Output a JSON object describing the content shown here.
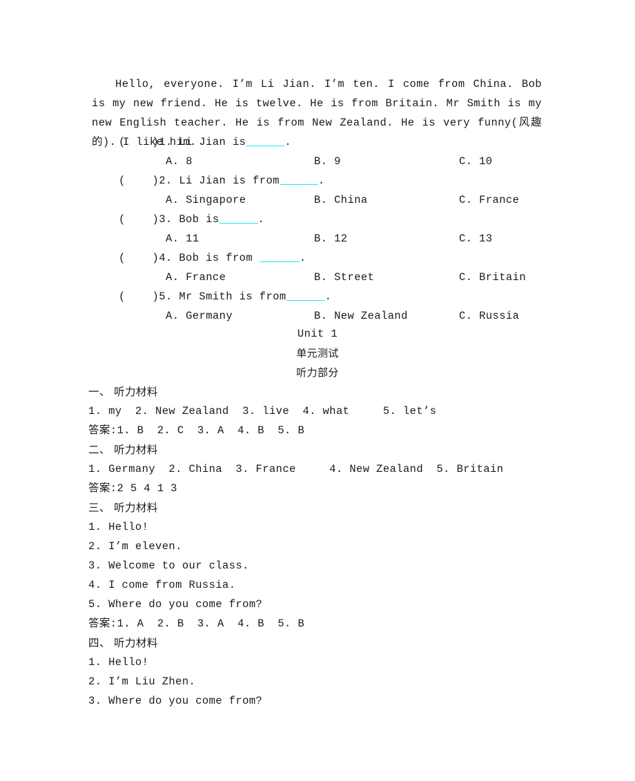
{
  "passage": {
    "text": "Hello, everyone. I’m Li Jian. I’m ten. I come from China. Bob is my new friend. He is twelve. He is from Britain. Mr Smith is my new English teacher. He is from New Zealand. He is very funny(风趣的). I like him."
  },
  "blank_color": "#19e8f0",
  "questions": [
    {
      "marker": "(    )1.",
      "stem_before": " Li Jian is",
      "stem_after": ".",
      "options": [
        "A. 8",
        "B. 9",
        "C. 10"
      ]
    },
    {
      "marker": "(    )2.",
      "stem_before": " Li Jian is from",
      "stem_after": ".",
      "options": [
        "A. Singapore",
        "B. China",
        "C. France"
      ]
    },
    {
      "marker": "(    )3.",
      "stem_before": " Bob is",
      "stem_after": ".",
      "options": [
        "A. 11",
        "B. 12",
        "C. 13"
      ]
    },
    {
      "marker": "(    )4.",
      "stem_before": " Bob is from ",
      "stem_after": ".",
      "options": [
        "A. France",
        "B. Street",
        "C. Britain"
      ]
    },
    {
      "marker": "(    )5.",
      "stem_before": " Mr Smith is from",
      "stem_after": ".",
      "options": [
        "A. Germany",
        "B. New Zealand",
        "C. Russia"
      ]
    }
  ],
  "title": {
    "line1": "Unit 1",
    "line2": "单元测试",
    "line3": "听力部分"
  },
  "keys": [
    {
      "heading": "一、 听力材料"
    },
    {
      "content": "1. my  2. New Zealand  3. live  4. what     5. let’s"
    },
    {
      "content": "答案:1. B  2. C  3. A  4. B  5. B"
    },
    {
      "heading": "二、 听力材料"
    },
    {
      "content": "1. Germany  2. China  3. France     4. New Zealand  5. Britain"
    },
    {
      "content": "答案:2 5 4 1 3"
    },
    {
      "heading": "三、 听力材料"
    },
    {
      "content": "1. Hello!"
    },
    {
      "content": "2. I’m eleven."
    },
    {
      "content": "3. Welcome to our class."
    },
    {
      "content": "4. I come from Russia."
    },
    {
      "content": "5. Where do you come from?"
    },
    {
      "content": "答案:1. A  2. B  3. A  4. B  5. B"
    },
    {
      "heading": "四、 听力材料"
    },
    {
      "content": "1. Hello!"
    },
    {
      "content": "2. I’m Liu Zhen."
    },
    {
      "content": "3. Where do you come from?"
    }
  ]
}
